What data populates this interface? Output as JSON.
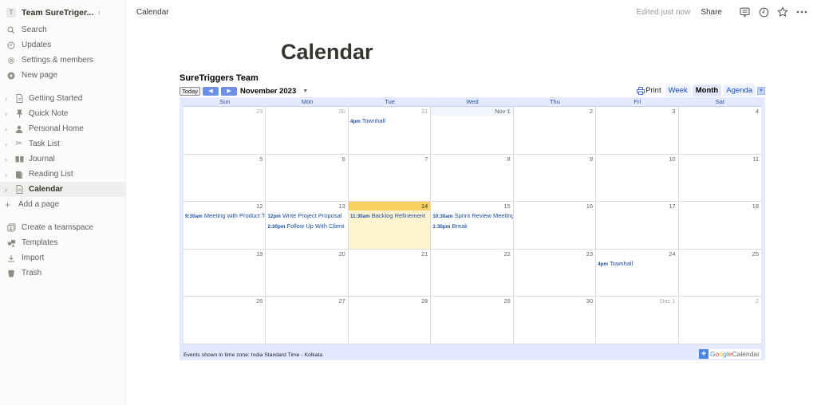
{
  "sidebar": {
    "workspace": {
      "initial": "T",
      "name": "Team SureTriger..."
    },
    "top_items": [
      {
        "label": "Search",
        "icon": "search-icon"
      },
      {
        "label": "Updates",
        "icon": "clock-icon"
      },
      {
        "label": "Settings & members",
        "icon": "gear-icon"
      },
      {
        "label": "New page",
        "icon": "plus-circle-icon"
      }
    ],
    "pages": [
      {
        "label": "Getting Started",
        "icon": "document-icon"
      },
      {
        "label": "Quick Note",
        "icon": "pin-icon"
      },
      {
        "label": "Personal Home",
        "icon": "person-icon"
      },
      {
        "label": "Task List",
        "icon": "scissors-icon"
      },
      {
        "label": "Journal",
        "icon": "book-icon"
      },
      {
        "label": "Reading List",
        "icon": "books-icon"
      },
      {
        "label": "Calendar",
        "icon": "document-icon",
        "active": true
      }
    ],
    "add_page": "Add a page",
    "bottom_items": [
      {
        "label": "Create a teamspace",
        "icon": "teamspace-icon"
      },
      {
        "label": "Templates",
        "icon": "templates-icon"
      },
      {
        "label": "Import",
        "icon": "import-icon"
      },
      {
        "label": "Trash",
        "icon": "trash-icon"
      }
    ]
  },
  "topbar": {
    "breadcrumb": "Calendar",
    "edited": "Edited just now",
    "share": "Share"
  },
  "page": {
    "title": "Calendar"
  },
  "calendar": {
    "title": "SureTriggers Team",
    "today_label": "Today",
    "month_label": "November 2023",
    "print_label": "Print",
    "views": [
      "Week",
      "Month",
      "Agenda"
    ],
    "selected_view": "Month",
    "weekdays": [
      "Sun",
      "Mon",
      "Tue",
      "Wed",
      "Thu",
      "Fri",
      "Sat"
    ],
    "weeks": [
      [
        {
          "day": "29",
          "other": true
        },
        {
          "day": "30",
          "other": true
        },
        {
          "day": "31",
          "other": true,
          "events": [
            {
              "time": "4pm",
              "title": "Townhall"
            }
          ]
        },
        {
          "day": "Nov 1",
          "shade": true
        },
        {
          "day": "2"
        },
        {
          "day": "3"
        },
        {
          "day": "4"
        }
      ],
      [
        {
          "day": "5"
        },
        {
          "day": "6"
        },
        {
          "day": "7"
        },
        {
          "day": "8"
        },
        {
          "day": "9"
        },
        {
          "day": "10"
        },
        {
          "day": "11"
        }
      ],
      [
        {
          "day": "12",
          "events": [
            {
              "time": "9:30am",
              "title": "Meeting with Product Team"
            }
          ]
        },
        {
          "day": "13",
          "events": [
            {
              "time": "12pm",
              "title": "Write Project Proposal"
            },
            {
              "time": "2:30pm",
              "title": "Follow Up With Client"
            }
          ]
        },
        {
          "day": "14",
          "today": true,
          "events": [
            {
              "time": "11:30am",
              "title": "Backlog Refinement"
            }
          ]
        },
        {
          "day": "15",
          "events": [
            {
              "time": "10:30am",
              "title": "Sprint Review Meeting"
            },
            {
              "time": "1:30pm",
              "title": "Break"
            }
          ]
        },
        {
          "day": "16"
        },
        {
          "day": "17"
        },
        {
          "day": "18"
        }
      ],
      [
        {
          "day": "19"
        },
        {
          "day": "20"
        },
        {
          "day": "21"
        },
        {
          "day": "22"
        },
        {
          "day": "23"
        },
        {
          "day": "24",
          "events": [
            {
              "time": "4pm",
              "title": "Townhall"
            }
          ]
        },
        {
          "day": "25"
        }
      ],
      [
        {
          "day": "26"
        },
        {
          "day": "27"
        },
        {
          "day": "28"
        },
        {
          "day": "29"
        },
        {
          "day": "30"
        },
        {
          "day": "Dec 1",
          "other": true
        },
        {
          "day": "2",
          "other": true
        }
      ]
    ],
    "timezone_note": "Events shown in time zone: India Standard Time - Kolkata",
    "brand": {
      "google": [
        "G",
        "o",
        "o",
        "g",
        "l",
        "e"
      ],
      "calendar": "Calendar"
    }
  }
}
